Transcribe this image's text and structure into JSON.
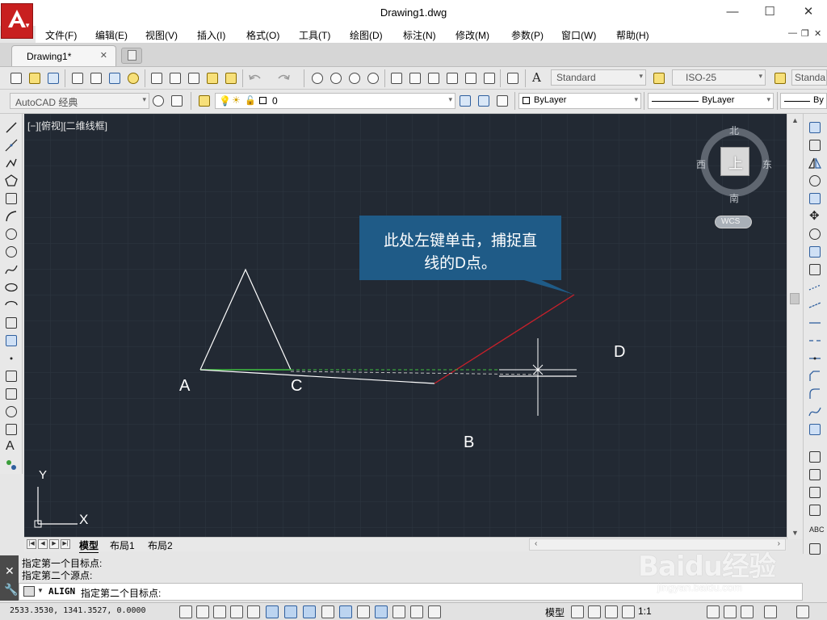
{
  "window": {
    "title": "Drawing1.dwg",
    "minimize": "—",
    "maximize": "☐",
    "close": "✕"
  },
  "menu": {
    "items": [
      "文件(F)",
      "编辑(E)",
      "视图(V)",
      "插入(I)",
      "格式(O)",
      "工具(T)",
      "绘图(D)",
      "标注(N)",
      "修改(M)",
      "参数(P)",
      "窗口(W)",
      "帮助(H)"
    ],
    "doc_minimize": "—",
    "doc_restore": "❐",
    "doc_close": "✕"
  },
  "tabs": {
    "document": "Drawing1*",
    "close": "✕"
  },
  "toolbar": {
    "text_style": "Standard",
    "dim_style": "ISO-25",
    "table_style": "Standa",
    "workspace": "AutoCAD 经典",
    "layer": "0",
    "color": "ByLayer",
    "linetype": "ByLayer",
    "lineweight": "By"
  },
  "canvas": {
    "view_label": "[−][俯视][二维线框]",
    "points": {
      "A": "A",
      "B": "B",
      "C": "C",
      "D": "D"
    },
    "callout_line1": "此处左键单击，捕捉直",
    "callout_line2": "线的D点。",
    "viewcube": {
      "north": "北",
      "south": "南",
      "east": "东",
      "west": "西",
      "top": "上",
      "wcs": "WCS"
    },
    "ucs": {
      "x": "X",
      "y": "Y"
    },
    "colors": {
      "background": "#222933",
      "callout": "#1f5b87",
      "red_line": "#c8202a",
      "green_line": "#3fbf3f"
    }
  },
  "layouts": {
    "tabs": [
      "模型",
      "布局1",
      "布局2"
    ],
    "active": "模型"
  },
  "command": {
    "history": [
      "指定第一个目标点:",
      "指定第二个源点:"
    ],
    "name": "ALIGN",
    "prompt": "指定第二个目标点:"
  },
  "status": {
    "coordinates": "2533.3530, 1341.3527, 0.0000",
    "model": "模型",
    "scale": "1:1"
  },
  "watermark": {
    "brand": "Baidu经验",
    "site": "jingyan.baidu.com"
  }
}
